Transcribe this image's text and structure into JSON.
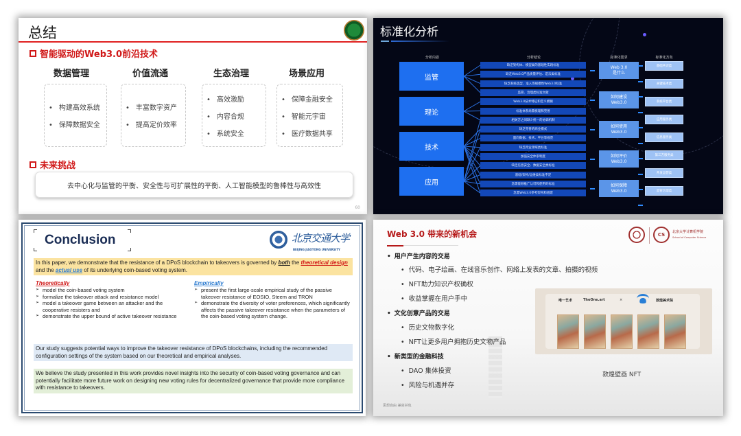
{
  "slides": {
    "summary": {
      "title": "总结",
      "section1": "智能驱动的Web3.0前沿技术",
      "columns": [
        {
          "heading": "数据管理",
          "items": [
            "构建高效系统",
            "保障数据安全"
          ]
        },
        {
          "heading": "价值流通",
          "items": [
            "丰富数字资产",
            "提高定价效率"
          ]
        },
        {
          "heading": "生态治理",
          "items": [
            "高效激励",
            "内容合规",
            "系统安全"
          ]
        },
        {
          "heading": "场景应用",
          "items": [
            "保障金融安全",
            "智能元宇宙",
            "医疗数据共享"
          ]
        }
      ],
      "section2": "未来挑战",
      "challenge_text": "去中心化与监管的平衡、安全性与可扩展性的平衡、人工智能模型的鲁棒性与高效性",
      "page_number": "60"
    },
    "standardization": {
      "title": "标准化分析",
      "column_headers": [
        "分析内容",
        "分析结论",
        "标准化需求",
        "标准化方向"
      ],
      "categories": [
        "监管",
        "理论",
        "技术",
        "应用"
      ],
      "issues": [
        "缺乏架构体、模型类的基础性实践标准",
        "缺乏Web3.0产品质量评估、是法类标准",
        "缺乏系统选型、准入等规模性Web3.0标准",
        "监管、治理类标准文献",
        "Web3.0技术特征和定义模糊",
        "标准体系尚需梳理和完善",
        "相关方之间缺少统一的协调机制",
        "缺乏完善的商业模式",
        "面向数据、技术、平台等规范",
        "缺乏跨业领域类标准",
        "加强安全体系制度",
        "缺乏信息安全、数据安全类标准",
        "基础/架构/运维类标准不足",
        "急需能够推广认可和使用的标准",
        "急需Web3.0参考架构和组建"
      ],
      "needs": [
        [
          "Web 3.0",
          "是什么"
        ],
        [
          "如何建设",
          "Web3.0"
        ],
        [
          "如何使用",
          "Web3.0"
        ],
        [
          "如何评价",
          "Web3.0"
        ],
        [
          "如何保障",
          "Web3.0"
        ]
      ],
      "directions": [
        "基础共识类",
        "关键技术类",
        "系统平台类",
        "应用服务类",
        "信息服务类",
        "第三方服务类",
        "开发运营类",
        "监管治理类"
      ]
    },
    "conclusion": {
      "title": "Conclusion",
      "university_cn": "北京交通大学",
      "university_en": "BEIJING JIAOTONG UNIVERSITY",
      "intro": {
        "part1": "In this paper, we demonstrate that the resistance of a DPoS blockchain to takeovers is governed by ",
        "both": "both",
        "part2": " the ",
        "theoretical": "theoretical design",
        "part3": " and the ",
        "actual": "actual use",
        "part4": " of its underlying coin-based voting system."
      },
      "theoretically": {
        "heading": "Theoretically",
        "items": [
          "model the coin-based voting system",
          "formalize the takeover attack and resistance model",
          "model a takeover game between an attacker and the cooperative resisters and",
          "demonstrate the upper bound of active takeover resistance"
        ]
      },
      "empirically": {
        "heading": "Empirically",
        "items": [
          "present the first large-scale empirical study of the passive takeover resistance of EOSIO, Steem and TRON",
          "demonstrate the diversity of voter preferences, which significantly affects the passive takeover resistance when the parameters of the coin-based voting system change."
        ]
      },
      "suggestion": "Our study suggests potential ways to improve the takeover resistance of DPoS blockchains, including the recommended configuration settings of the system based on our theoretical and empirical analyses.",
      "belief": "We believe the study presented in this work provides novel insights into the security of coin-based voting governance and can potentially facilitate more future work on designing new voting rules for decentralized governance that provide more compliance with resistance to takeovers."
    },
    "opportunities": {
      "title": "Web 3.0 带来的新机会",
      "school_cn": "北京大学计算机学院",
      "school_en": "School of Computer Science",
      "cs_logo": "CS",
      "groups": [
        {
          "heading": "用户产生内容的交易",
          "items": [
            "代码、电子绘画、在线音乐创作、网络上发表的文章、拍摄的视频",
            "NFT助力知识产权确权",
            "收益掌握在用户手中"
          ]
        },
        {
          "heading": "文化创意产品的交易",
          "items": [
            "历史文物数字化",
            "NFT让更多用户拥抱历史文物产品"
          ]
        },
        {
          "heading": "新类型的金融科技",
          "items": [
            "DAO 集体投资",
            "风险与机遇并存"
          ]
        }
      ],
      "image_labels": [
        "唯一艺术",
        "TheOne.art",
        "×",
        "敦煌美术院"
      ],
      "caption": "敦煌壁画 NFT",
      "footer": "思想自由 兼容并包"
    }
  }
}
